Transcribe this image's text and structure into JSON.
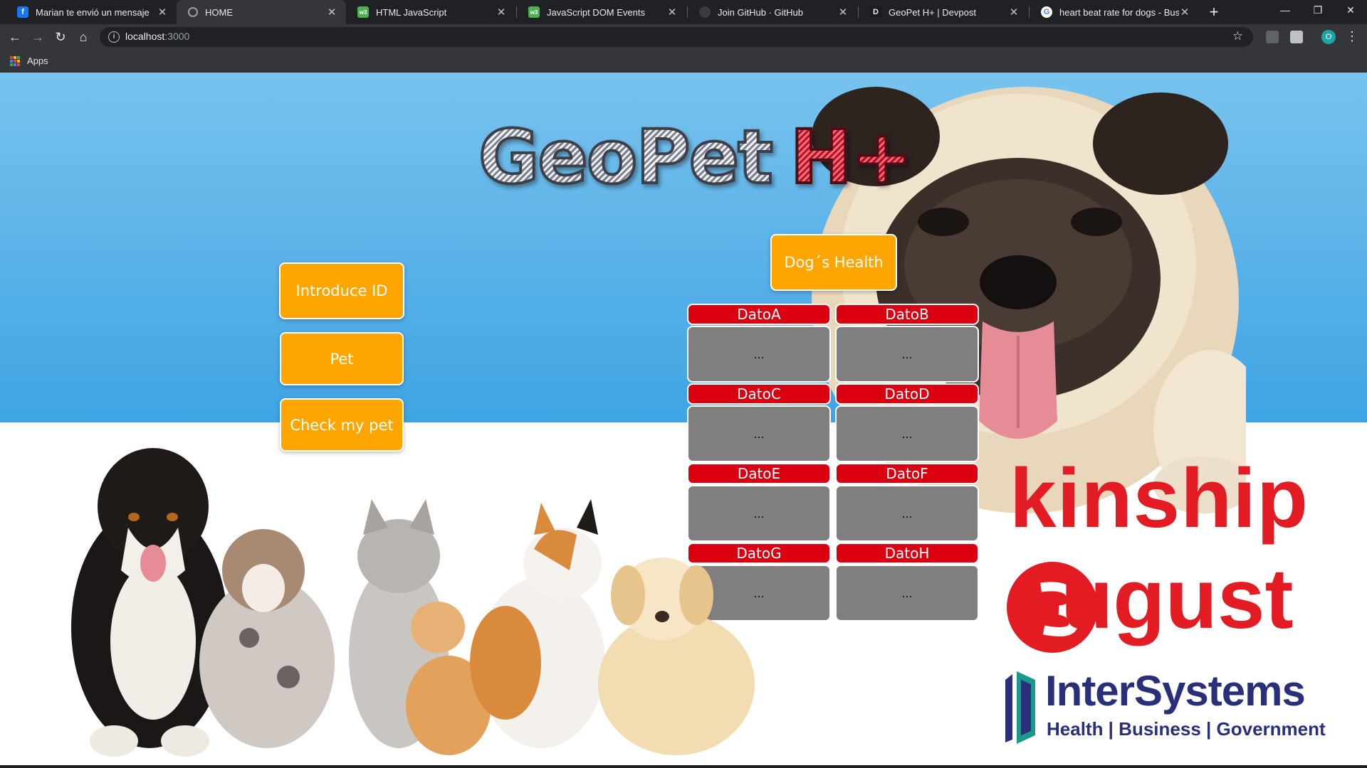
{
  "browser": {
    "tabs": [
      {
        "title": "Marian te envió un mensaje",
        "icon": "facebook-icon",
        "color": "#1877f2",
        "glyph": "f"
      },
      {
        "title": "HOME",
        "icon": "globe-icon",
        "color": "#5f6368",
        "glyph": ""
      },
      {
        "title": "HTML JavaScript",
        "icon": "w3schools-icon",
        "color": "#4caf50",
        "glyph": "w3"
      },
      {
        "title": "JavaScript DOM Events",
        "icon": "w3schools-icon",
        "color": "#4caf50",
        "glyph": "w3"
      },
      {
        "title": "Join GitHub · GitHub",
        "icon": "github-icon",
        "color": "#3a3b3e",
        "glyph": ""
      },
      {
        "title": "GeoPet H+ | Devpost",
        "icon": "devpost-icon",
        "color": "#003e54",
        "glyph": "D"
      },
      {
        "title": "heart beat rate for dogs - Buscar",
        "icon": "google-icon",
        "color": "#ffffff",
        "glyph": "G"
      }
    ],
    "active_tab": 1,
    "url_host": "localhost",
    "url_port": ":3000",
    "profile_initial": "O",
    "bookmarks_apps_label": "Apps"
  },
  "page": {
    "logo": {
      "main": "GeoPet",
      "accent": "H+"
    },
    "buttons": {
      "introduce_id": "Introduce ID",
      "pet": "Pet",
      "check_my_pet": "Check my pet",
      "dogs_health": "Dog´s Health"
    },
    "data_cells": [
      {
        "label": "DatoA",
        "value": "..."
      },
      {
        "label": "DatoB",
        "value": "..."
      },
      {
        "label": "DatoC",
        "value": "..."
      },
      {
        "label": "DatoD",
        "value": "..."
      },
      {
        "label": "DatoE",
        "value": "..."
      },
      {
        "label": "DatoF",
        "value": "..."
      },
      {
        "label": "DatoG",
        "value": "..."
      },
      {
        "label": "DatoH",
        "value": "..."
      }
    ],
    "sponsors": {
      "kinship": "kinship",
      "august": "ugust",
      "intersystems_name": "InterSystems",
      "intersystems_tagline": "Health | Business | Government"
    },
    "colors": {
      "orange_button": "#fea500",
      "label_red": "#da0010",
      "value_grey": "#7f7f7f",
      "sky_blue": "#62b6ea",
      "kinship_red": "#e31b23",
      "intersystems_navy": "#2a2f7a"
    }
  }
}
